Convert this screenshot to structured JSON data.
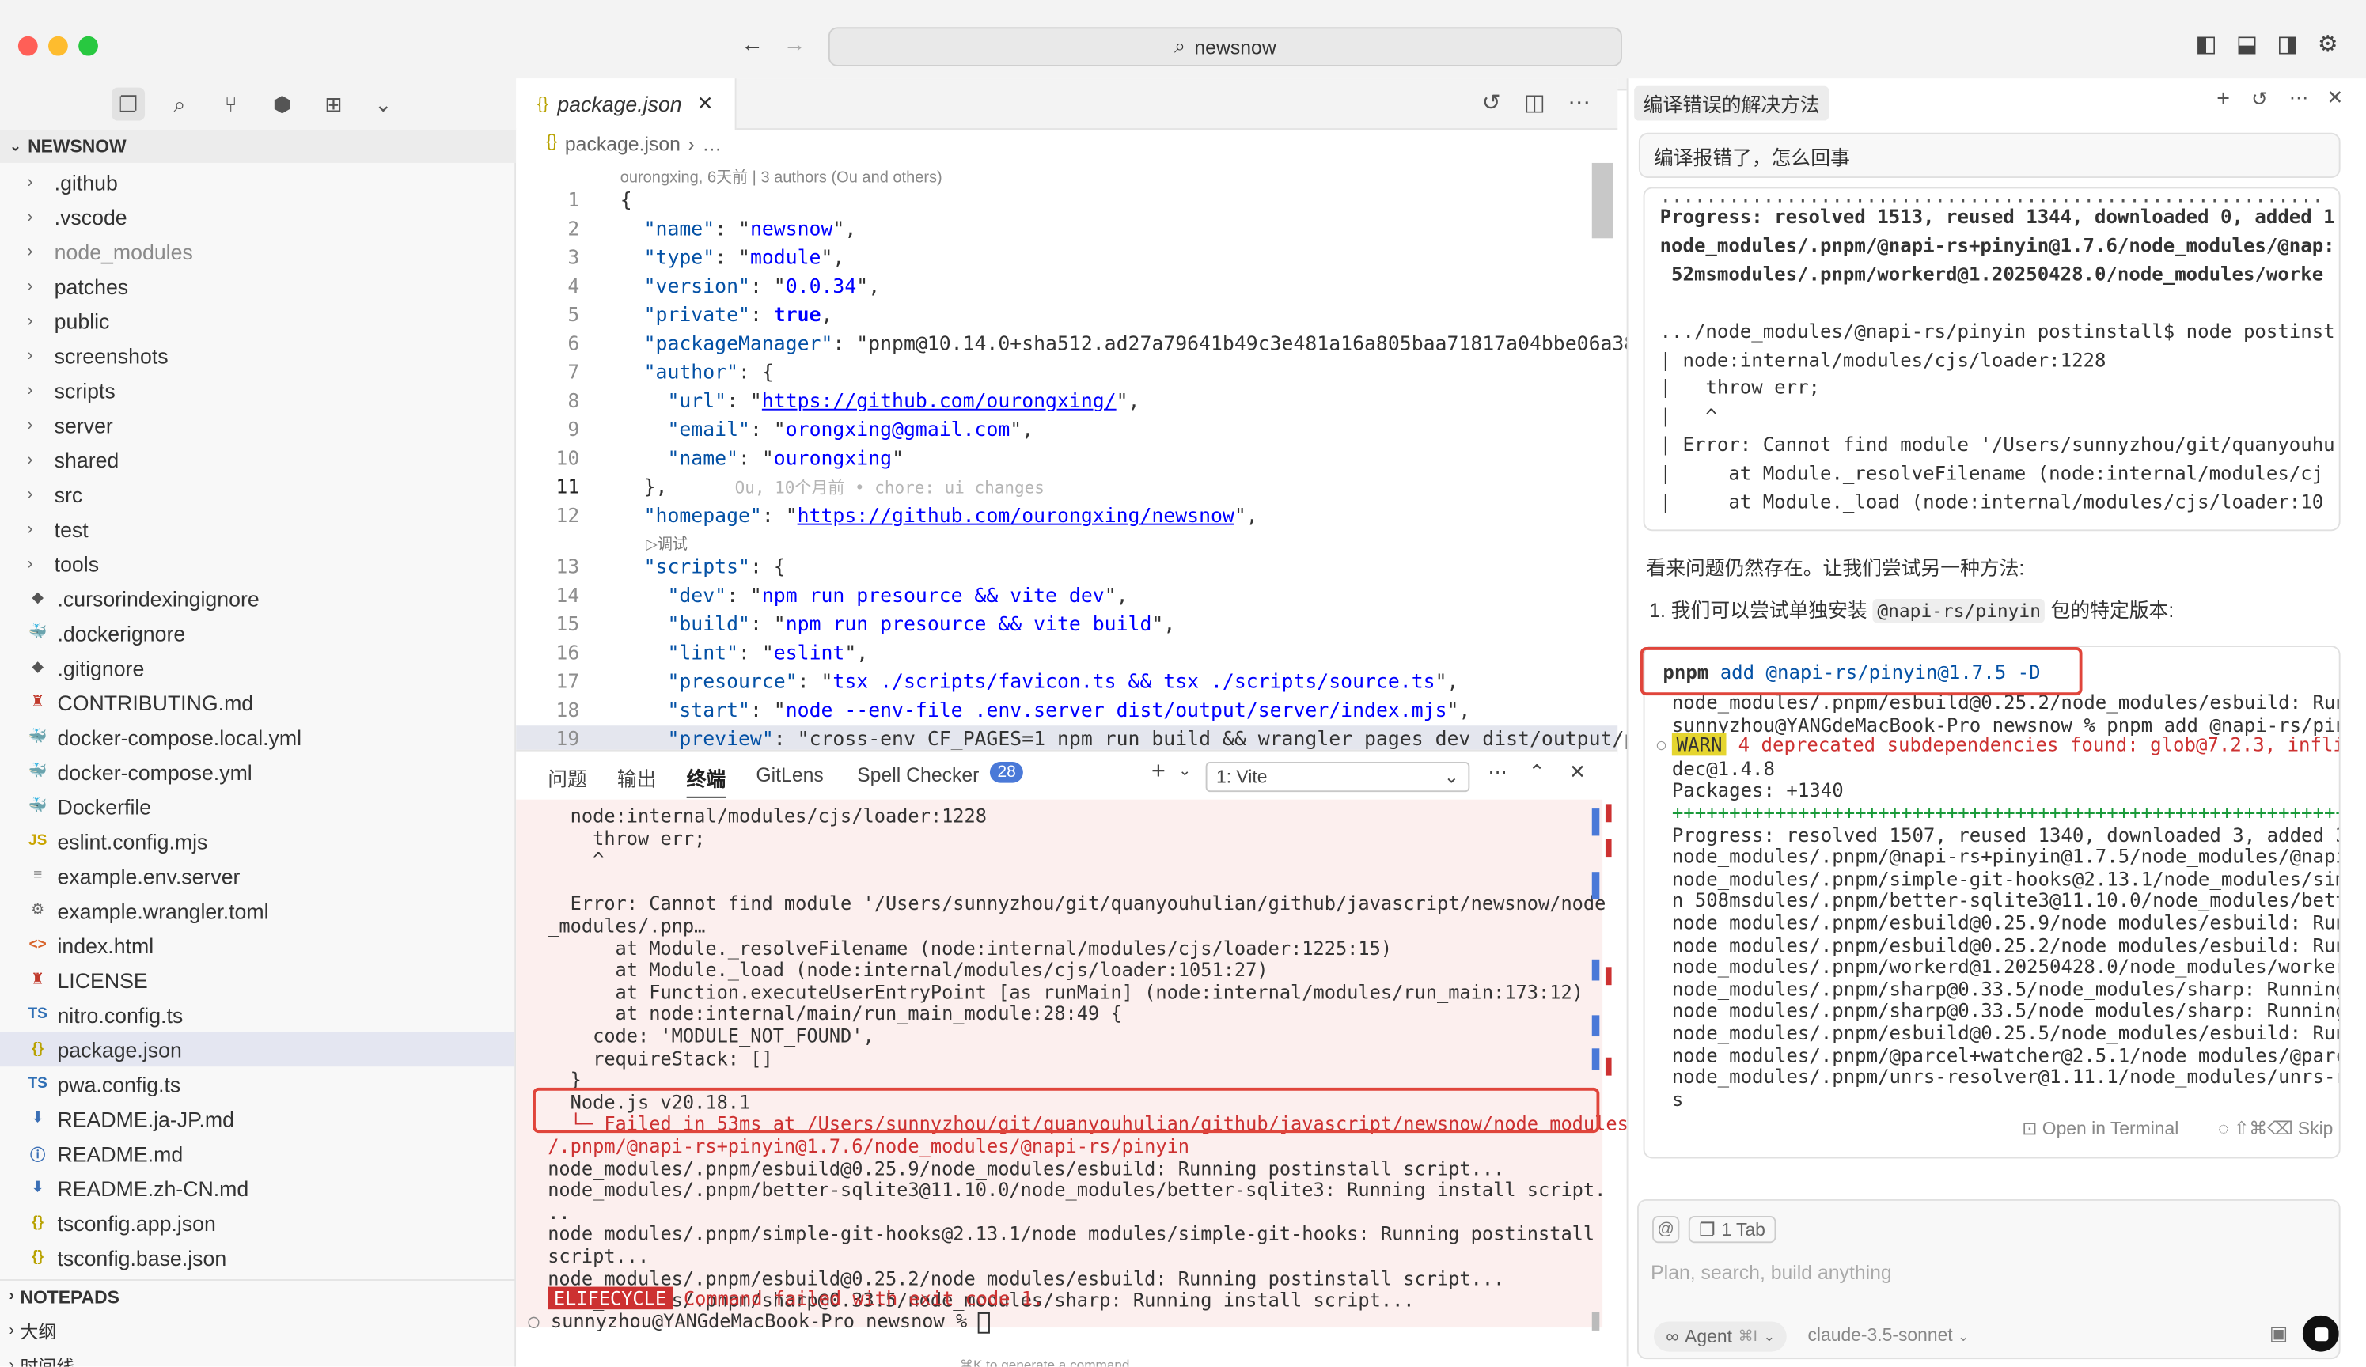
{
  "window": {
    "search_text": "newsnow"
  },
  "sidebar": {
    "project_title": "NEWSNOW",
    "items": [
      {
        "label": ".github",
        "type": "folder"
      },
      {
        "label": ".vscode",
        "type": "folder"
      },
      {
        "label": "node_modules",
        "type": "folder",
        "dim": true
      },
      {
        "label": "patches",
        "type": "folder"
      },
      {
        "label": "public",
        "type": "folder"
      },
      {
        "label": "screenshots",
        "type": "folder"
      },
      {
        "label": "scripts",
        "type": "folder"
      },
      {
        "label": "server",
        "type": "folder"
      },
      {
        "label": "shared",
        "type": "folder"
      },
      {
        "label": "src",
        "type": "folder"
      },
      {
        "label": "test",
        "type": "folder"
      },
      {
        "label": "tools",
        "type": "folder"
      },
      {
        "label": ".cursorindexingignore",
        "type": "file",
        "icon": "git-icon"
      },
      {
        "label": ".dockerignore",
        "type": "file",
        "icon": "docker-icon"
      },
      {
        "label": ".gitignore",
        "type": "file",
        "icon": "git-icon"
      },
      {
        "label": "CONTRIBUTING.md",
        "type": "file",
        "icon": "person-icon"
      },
      {
        "label": "docker-compose.local.yml",
        "type": "file",
        "icon": "docker-icon"
      },
      {
        "label": "docker-compose.yml",
        "type": "file",
        "icon": "docker-icon"
      },
      {
        "label": "Dockerfile",
        "type": "file",
        "icon": "docker-icon"
      },
      {
        "label": "eslint.config.mjs",
        "type": "file",
        "icon": "js-icon",
        "icon_text": "JS"
      },
      {
        "label": "example.env.server",
        "type": "file",
        "icon": "lines-icon"
      },
      {
        "label": "example.wrangler.toml",
        "type": "file",
        "icon": "gear-icon"
      },
      {
        "label": "index.html",
        "type": "file",
        "icon": "html-icon"
      },
      {
        "label": "LICENSE",
        "type": "file",
        "icon": "person-icon"
      },
      {
        "label": "nitro.config.ts",
        "type": "file",
        "icon": "ts-icon",
        "icon_text": "TS"
      },
      {
        "label": "package.json",
        "type": "file",
        "icon": "json-icon",
        "selected": true
      },
      {
        "label": "pwa.config.ts",
        "type": "file",
        "icon": "ts-icon",
        "icon_text": "TS"
      },
      {
        "label": "README.ja-JP.md",
        "type": "file",
        "icon": "download-icon"
      },
      {
        "label": "README.md",
        "type": "file",
        "icon": "info-icon"
      },
      {
        "label": "README.zh-CN.md",
        "type": "file",
        "icon": "download-icon"
      },
      {
        "label": "tsconfig.app.json",
        "type": "file",
        "icon": "json-icon"
      },
      {
        "label": "tsconfig.base.json",
        "type": "file",
        "icon": "json-icon"
      }
    ],
    "notepads": "NOTEPADS",
    "outline": "大纲",
    "timeline": "时间线"
  },
  "editor": {
    "tab_label": "package.json",
    "breadcrumb_file": "package.json",
    "breadcrumb_more": "…",
    "blame": "ourongxing, 6天前 | 3 authors (Ou and others)",
    "inline_blame": "Ou, 10个月前 • chore: ui changes",
    "debug_label": "▷调试",
    "lines": [
      {
        "n": "1",
        "t": "{"
      },
      {
        "n": "2",
        "t": "  \"name\": \"newsnow\","
      },
      {
        "n": "3",
        "t": "  \"type\": \"module\","
      },
      {
        "n": "4",
        "t": "  \"version\": \"0.0.34\","
      },
      {
        "n": "5",
        "t": "  \"private\": true,"
      },
      {
        "n": "6",
        "t": "  \"packageManager\": \"pnpm@10.14.0+sha512.ad27a79641b49c3e481a16a805baa71817a04bbe06a38d"
      },
      {
        "n": "7",
        "t": "  \"author\": {"
      },
      {
        "n": "8",
        "t": "    \"url\": \"https://github.com/ourongxing/\","
      },
      {
        "n": "9",
        "t": "    \"email\": \"orongxing@gmail.com\","
      },
      {
        "n": "10",
        "t": "    \"name\": \"ourongxing\""
      },
      {
        "n": "11",
        "t": "  },"
      },
      {
        "n": "12",
        "t": "  \"homepage\": \"https://github.com/ourongxing/newsnow\","
      },
      {
        "n": "13",
        "t": "  \"scripts\": {"
      },
      {
        "n": "14",
        "t": "    \"dev\": \"npm run presource && vite dev\","
      },
      {
        "n": "15",
        "t": "    \"build\": \"npm run presource && vite build\","
      },
      {
        "n": "16",
        "t": "    \"lint\": \"eslint\","
      },
      {
        "n": "17",
        "t": "    \"presource\": \"tsx ./scripts/favicon.ts && tsx ./scripts/source.ts\","
      },
      {
        "n": "18",
        "t": "    \"start\": \"node --env-file .env.server dist/output/server/index.mjs\","
      },
      {
        "n": "19",
        "t": "    \"preview\": \"cross-env CF_PAGES=1 npm run build && wrangler pages dev dist/output/pu"
      }
    ]
  },
  "panel": {
    "tabs": [
      "问题",
      "输出",
      "终端",
      "GitLens",
      "Spell Checker"
    ],
    "spell_badge": "28",
    "terminal_select": "1: Vite",
    "lines": [
      "  node:internal/modules/cjs/loader:1228",
      "    throw err;",
      "    ^",
      "",
      "  Error: Cannot find module '/Users/sunnyzhou/git/quanyouhulian/github/javascript/newsnow/node",
      "_modules/.pnp…",
      "      at Module._resolveFilename (node:internal/modules/cjs/loader:1225:15)",
      "      at Module._load (node:internal/modules/cjs/loader:1051:27)",
      "      at Function.executeUserEntryPoint [as runMain] (node:internal/modules/run_main:173:12)",
      "      at node:internal/main/run_main_module:28:49 {",
      "    code: 'MODULE_NOT_FOUND',",
      "    requireStack: []",
      "  }",
      "  Node.js v20.18.1",
      "  └─ Failed in 53ms at /Users/sunnyzhou/git/quanyouhulian/github/javascript/newsnow/node_modules",
      "/.pnpm/@napi-rs+pinyin@1.7.6/node_modules/@napi-rs/pinyin",
      "node_modules/.pnpm/esbuild@0.25.9/node_modules/esbuild: Running postinstall script...",
      "node_modules/.pnpm/better-sqlite3@11.10.0/node_modules/better-sqlite3: Running install script.",
      "..",
      "node_modules/.pnpm/simple-git-hooks@2.13.1/node_modules/simple-git-hooks: Running postinstall",
      "script...",
      "node_modules/.pnpm/esbuild@0.25.2/node_modules/esbuild: Running postinstall script...",
      "node_modules/.pnpm/sharp@0.33.5/node_modules/sharp: Running install script..."
    ],
    "elifecycle_badge": "ELIFECYCLE",
    "elifecycle_msg": " Command failed with exit code 1.",
    "prompt": "sunnyzhou@YANGdeMacBook-Pro newsnow % ",
    "footer_hint": "⌘K to generate a command"
  },
  "chat": {
    "title": "编译错误的解决方法",
    "user_message": "编译报错了，怎么回事",
    "output1": [
      {
        "t": "Progress: resolved 1513, reused 1344, downloaded 0, added 1",
        "b": true
      },
      {
        "t": "node_modules/.pnpm/@napi-rs+pinyin@1.7.6/node_modules/@nap:",
        "b": true
      },
      {
        "t": " 52msmodules/.pnpm/workerd@1.20250428.0/node_modules/worke",
        "b": true
      },
      {
        "t": "",
        "b": false
      },
      {
        "t": ".../node_modules/@napi-rs/pinyin postinstall$ node postinst",
        "b": false
      },
      {
        "t": "| node:internal/modules/cjs/loader:1228",
        "b": false
      },
      {
        "t": "|   throw err;",
        "b": false
      },
      {
        "t": "|   ^",
        "b": false
      },
      {
        "t": "| Error: Cannot find module '/Users/sunnyzhou/git/quanyouhu",
        "b": false
      },
      {
        "t": "|     at Module._resolveFilename (node:internal/modules/cj",
        "b": false
      },
      {
        "t": "|     at Module._load (node:internal/modules/cjs/loader:10",
        "b": false
      }
    ],
    "text1": "看来问题仍然存在。让我们尝试另一种方法:",
    "text2_prefix": "1. 我们可以尝试单独安装 ",
    "text2_code": "@napi-rs/pinyin",
    "text2_suffix": " 包的特定版本:",
    "command_bin": "pnpm",
    "command_args": " add @napi-rs/pinyin@1.7.5 -D",
    "output2": [
      "node_modules/.pnpm/esbuild@0.25.2/node_modules/esbuild: Runn",
      "sunnyzhou@YANGdeMacBook-Pro newsnow % pnpm add @napi-rs/piny",
      "",
      "dec@1.4.8",
      "Packages: +1340",
      "+++++++++++++++++++++++++++++++++++++++++++++++++++++++++++++",
      "Progress: resolved 1507, reused 1340, downloaded 3, added 3,",
      "node_modules/.pnpm/@napi-rs+pinyin@1.7.5/node_modules/@napi-",
      "node_modules/.pnpm/simple-git-hooks@2.13.1/node_modules/simp",
      "n 508msdules/.pnpm/better-sqlite3@11.10.0/node_modules/bette",
      "node_modules/.pnpm/esbuild@0.25.9/node_modules/esbuild: Runn",
      "node_modules/.pnpm/esbuild@0.25.2/node_modules/esbuild: Runn",
      "node_modules/.pnpm/workerd@1.20250428.0/node_modules/workerd",
      "node_modules/.pnpm/sharp@0.33.5/node_modules/sharp: Running",
      "node_modules/.pnpm/sharp@0.33.5/node_modules/sharp: Running",
      "node_modules/.pnpm/esbuild@0.25.5/node_modules/esbuild: Runn",
      "node_modules/.pnpm/@parcel+watcher@2.5.1/node_modules/@parce",
      "node_modules/.pnpm/unrs-resolver@1.11.1/node_modules/unrs-re",
      "s"
    ],
    "warn_badge": "WARN",
    "warn_text": " 4 deprecated subdependencies found: glob@7.2.3, infli",
    "open_terminal": "Open in Terminal",
    "skip": "⇧⌘⌫ Skip",
    "tab_chip": "1 Tab",
    "input_placeholder": "Plan, search, build anything",
    "agent_label": "Agent",
    "agent_shortcut": "⌘I",
    "model": "claude-3.5-sonnet"
  }
}
